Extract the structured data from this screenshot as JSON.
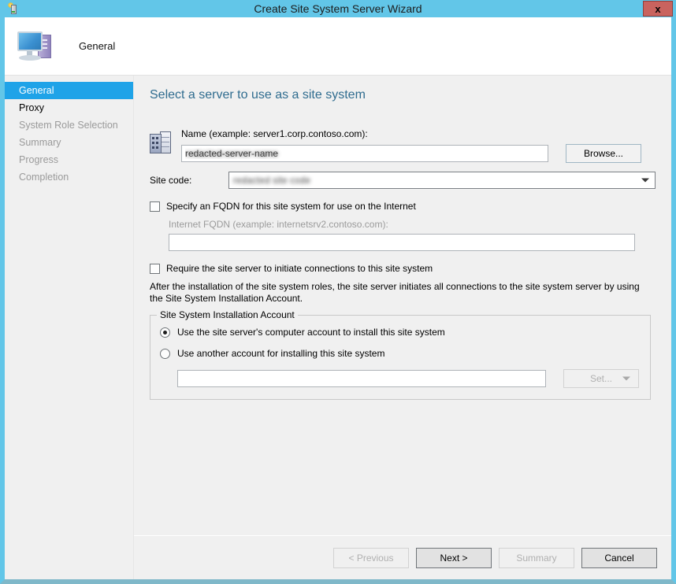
{
  "window": {
    "title": "Create Site System Server Wizard",
    "close_label": "x",
    "titlebar_icon": "server-wizard-icon",
    "accent_color": "#62c6e8",
    "close_color": "#c9635e"
  },
  "header": {
    "icon": "computer-icon",
    "title": "General"
  },
  "sidebar": {
    "items": [
      {
        "label": "General",
        "state": "active"
      },
      {
        "label": "Proxy",
        "state": "enabled"
      },
      {
        "label": "System Role Selection",
        "state": "disabled"
      },
      {
        "label": "Summary",
        "state": "disabled"
      },
      {
        "label": "Progress",
        "state": "disabled"
      },
      {
        "label": "Completion",
        "state": "disabled"
      }
    ]
  },
  "main": {
    "heading": "Select a server to use as a site system",
    "name": {
      "icon": "building-icon",
      "label": "Name (example: server1.corp.contoso.com):",
      "value": "redacted-server-name",
      "placeholder": "",
      "browse_label": "Browse..."
    },
    "site_code": {
      "label": "Site code:",
      "value": "redacted site code",
      "options": [
        "redacted site code"
      ]
    },
    "fqdn": {
      "checkbox_label": "Specify an FQDN for this site system for use on the Internet",
      "checked": false,
      "sub_label": "Internet FQDN (example: internetsrv2.contoso.com):",
      "value": "",
      "enabled": false
    },
    "require_initiate": {
      "checkbox_label": "Require the site server to initiate connections to this site system",
      "checked": false
    },
    "note": "After the  installation of the site system roles, the site server initiates all connections to the site system server by using the Site System Installation Account.",
    "install_account": {
      "group_title": "Site System Installation Account",
      "options": [
        {
          "label": "Use the site server's computer account to install this site system",
          "selected": true
        },
        {
          "label": "Use another account for installing this site system",
          "selected": false
        }
      ],
      "account_value": "",
      "set_label": "Set...",
      "set_enabled": false
    }
  },
  "footer": {
    "buttons": [
      {
        "label": "< Previous",
        "enabled": false
      },
      {
        "label": "Next >",
        "enabled": true
      },
      {
        "label": "Summary",
        "enabled": false
      },
      {
        "label": "Cancel",
        "enabled": true
      }
    ]
  }
}
